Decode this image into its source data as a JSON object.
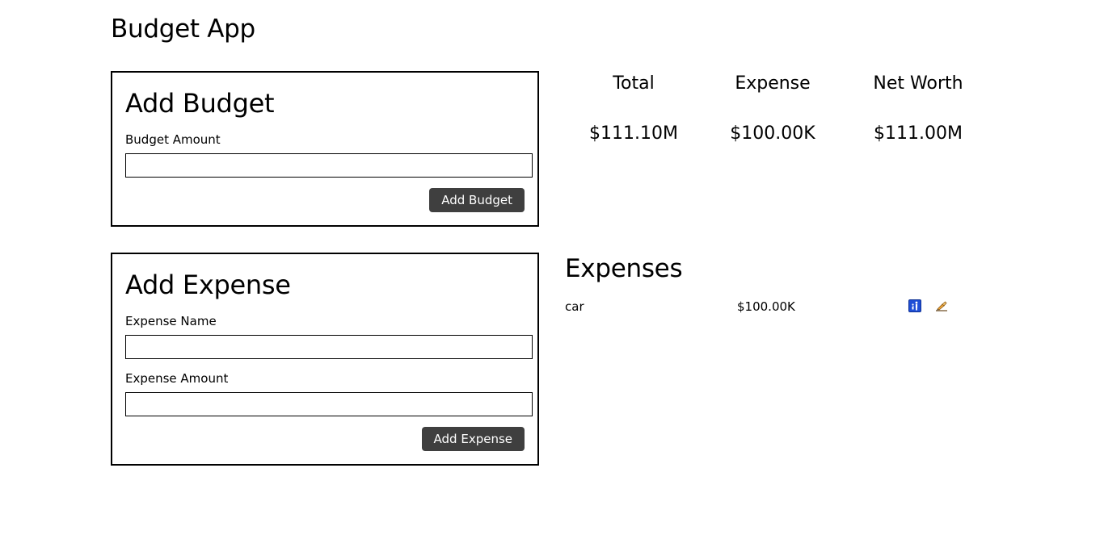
{
  "app": {
    "title": "Budget App"
  },
  "add_budget": {
    "title": "Add Budget",
    "amount_label": "Budget Amount",
    "amount_value": "",
    "amount_placeholder": "",
    "button_label": "Add Budget"
  },
  "add_expense": {
    "title": "Add Expense",
    "name_label": "Expense Name",
    "name_value": "",
    "name_placeholder": "",
    "amount_label": "Expense Amount",
    "amount_value": "",
    "amount_placeholder": "",
    "button_label": "Add Expense"
  },
  "summary": {
    "total": {
      "label": "Total",
      "value": "$111.10M"
    },
    "expense": {
      "label": "Expense",
      "value": "$100.00K"
    },
    "net_worth": {
      "label": "Net Worth",
      "value": "$111.00M"
    }
  },
  "expenses": {
    "heading": "Expenses",
    "items": [
      {
        "name": "car",
        "amount": "$100.00K",
        "actions": [
          {
            "icon": "restroom-icon",
            "color": "#1f4fd6"
          },
          {
            "icon": "writing-hand-icon",
            "color": "#f2a93b"
          }
        ]
      }
    ]
  },
  "colors": {
    "button_background": "#3f3f3f",
    "button_text": "#ffffff",
    "card_border": "#000000"
  }
}
